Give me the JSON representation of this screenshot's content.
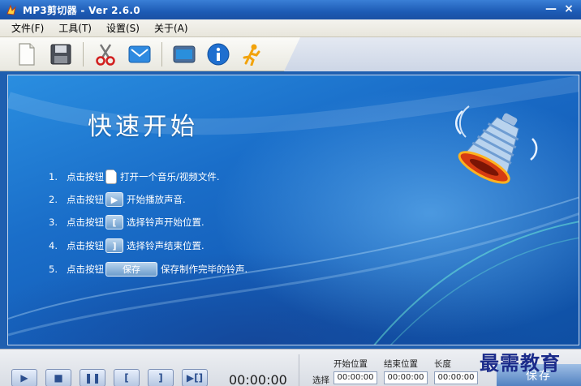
{
  "window": {
    "title": "MP3剪切器 - Ver 2.6.0",
    "minimize": "—",
    "close": "×"
  },
  "menu": {
    "items": [
      {
        "label": "文件(F)"
      },
      {
        "label": "工具(T)"
      },
      {
        "label": "设置(S)"
      },
      {
        "label": "关于(A)"
      }
    ]
  },
  "toolbar": {
    "buttons": [
      "new-file-icon",
      "save-disk-icon",
      "scissors-icon",
      "mail-icon",
      "window-icon",
      "info-icon",
      "runner-icon"
    ]
  },
  "quick_start": {
    "title": "快速开始",
    "steps": [
      {
        "num": "1.",
        "prefix": "点击按钮",
        "button": "",
        "text": "打开一个音乐/视频文件."
      },
      {
        "num": "2.",
        "prefix": "点击按钮",
        "button": "▶",
        "text": "开始播放声音."
      },
      {
        "num": "3.",
        "prefix": "点击按钮",
        "button": "[",
        "text": "选择铃声开始位置."
      },
      {
        "num": "4.",
        "prefix": "点击按钮",
        "button": "]",
        "text": "选择铃声结束位置."
      },
      {
        "num": "5.",
        "prefix": "点击按钮",
        "button": "保存",
        "text": "保存制作完毕的铃声."
      }
    ]
  },
  "player": {
    "controls": [
      "▶",
      "■",
      "❚❚",
      "[",
      "]",
      "▶[]"
    ],
    "time": "00:00:00",
    "start_label": "开始位置",
    "end_label": "结束位置",
    "length_label": "长度",
    "select_label": "选择",
    "start_value": "00:00:00",
    "end_value": "00:00:00",
    "length_value": "00:00:00",
    "save_label": "保存"
  },
  "watermark": "最需教育",
  "colors": {
    "titlebar": "#1d5bb5",
    "content_bg": "#1a6ec9",
    "accent": "#2c4f8f"
  }
}
